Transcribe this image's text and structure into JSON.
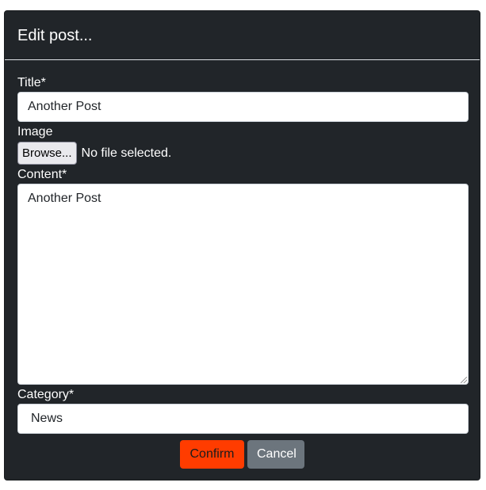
{
  "modal": {
    "title": "Edit post..."
  },
  "form": {
    "title_label": "Title*",
    "title_value": "Another Post",
    "image_label": "Image",
    "browse_label": "Browse...",
    "file_status": "No file selected.",
    "content_label": "Content*",
    "content_value": "Another Post",
    "category_label": "Category*",
    "category_value": "News"
  },
  "actions": {
    "confirm_label": "Confirm",
    "cancel_label": "Cancel"
  },
  "colors": {
    "modal_background": "#212529",
    "confirm_accent": "#ff3c00",
    "cancel_background": "#6c757d"
  }
}
